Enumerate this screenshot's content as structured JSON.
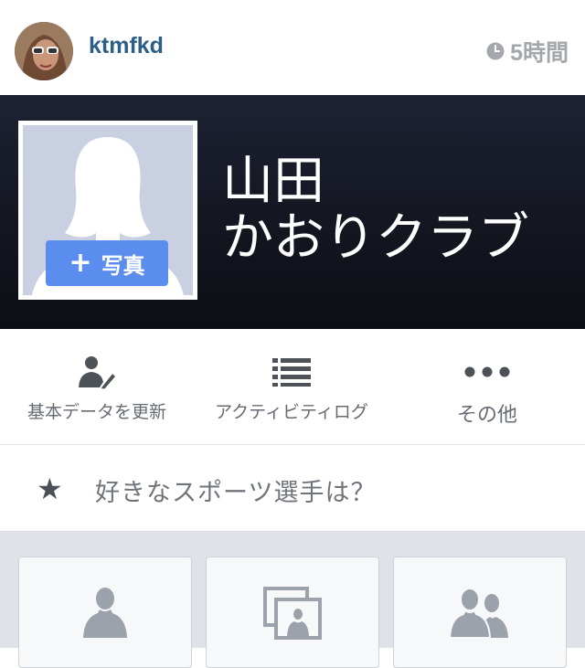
{
  "header": {
    "username": "ktmfkd",
    "time": "5時間",
    "clock_icon": "clock-icon",
    "avatar_icon": "user-avatar"
  },
  "cover": {
    "title_line1": "山田",
    "title_line2": "かおりクラブ",
    "add_photo_label": "写真",
    "add_photo_icon": "plus-icon"
  },
  "actions": [
    {
      "label": "基本データを更新",
      "icon": "edit-person-icon"
    },
    {
      "label": "アクティビティログ",
      "icon": "list-icon"
    },
    {
      "label": "その他",
      "icon": "more-icon"
    }
  ],
  "question": {
    "text": "好きなスポーツ選手は？",
    "icon": "star-icon"
  },
  "cards": [
    {
      "icon": "person-icon"
    },
    {
      "icon": "photos-icon"
    },
    {
      "icon": "friends-icon"
    }
  ],
  "colors": {
    "username": "#2c5e8a",
    "cover_bg": "#13151f",
    "add_photo": "#5b8def",
    "card_bg": "#f7f8fa"
  }
}
